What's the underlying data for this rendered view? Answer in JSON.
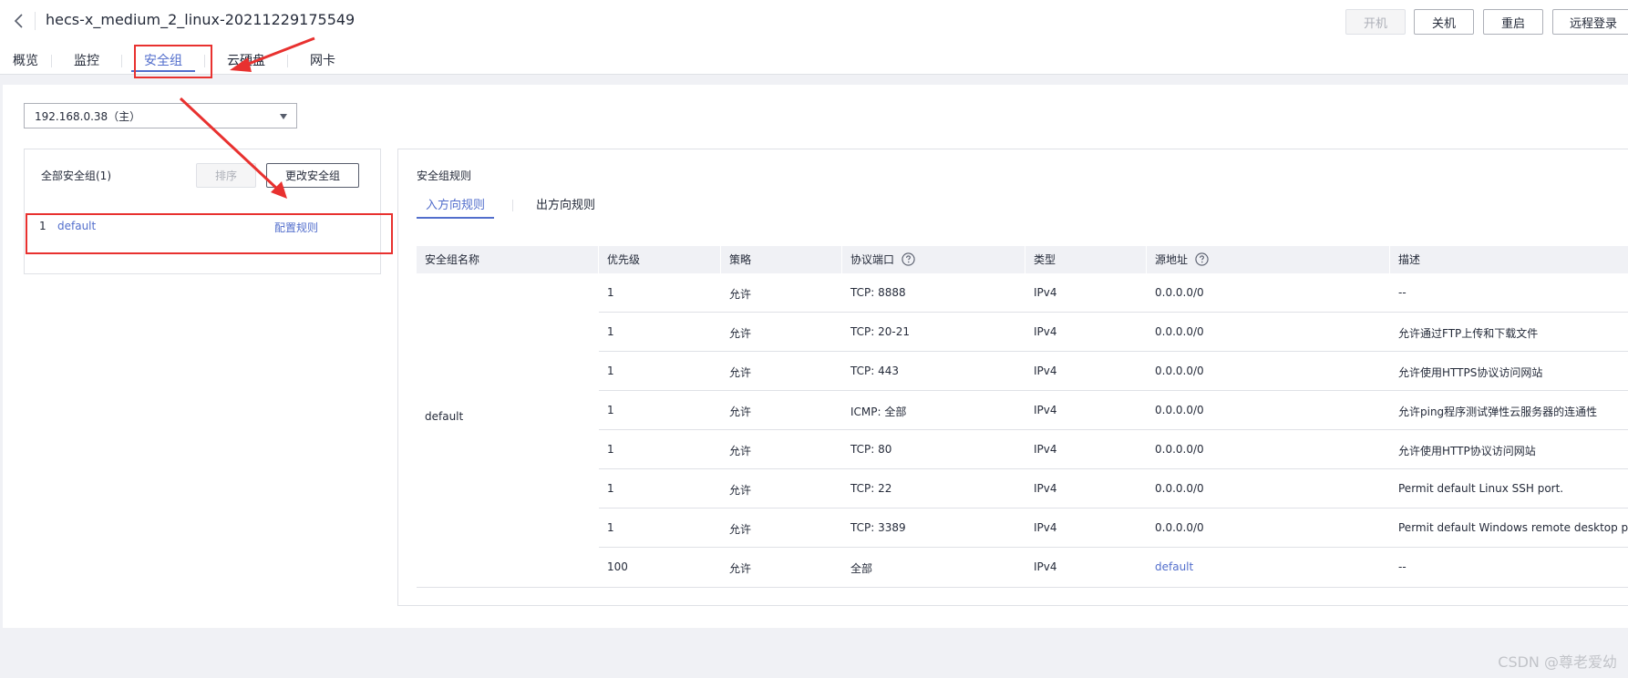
{
  "header": {
    "title": "hecs-x_medium_2_linux-20211229175549",
    "buttons": {
      "start": "开机",
      "stop": "关机",
      "restart": "重启",
      "remote_login": "远程登录"
    }
  },
  "tabs": [
    {
      "label": "概览"
    },
    {
      "label": "监控"
    },
    {
      "label": "安全组"
    },
    {
      "label": "云硬盘"
    },
    {
      "label": "网卡"
    }
  ],
  "nic_select": {
    "value": "192.168.0.38（主）"
  },
  "security_groups": {
    "count_label": "全部安全组(1)",
    "sort_label": "排序",
    "change_label": "更改安全组",
    "items": [
      {
        "index": "1",
        "name": "default",
        "action": "配置规则"
      }
    ]
  },
  "rules": {
    "title": "安全组规则",
    "direction_tabs": [
      "入方向规则",
      "出方向规则"
    ],
    "columns": [
      "安全组名称",
      "优先级",
      "策略",
      "协议端口",
      "类型",
      "源地址",
      "描述"
    ],
    "group_name": "default",
    "rows": [
      {
        "priority": "1",
        "policy": "允许",
        "port": "TCP: 8888",
        "type": "IPv4",
        "source": "0.0.0.0/0",
        "desc": "--"
      },
      {
        "priority": "1",
        "policy": "允许",
        "port": "TCP: 20-21",
        "type": "IPv4",
        "source": "0.0.0.0/0",
        "desc": "允许通过FTP上传和下载文件"
      },
      {
        "priority": "1",
        "policy": "允许",
        "port": "TCP: 443",
        "type": "IPv4",
        "source": "0.0.0.0/0",
        "desc": "允许使用HTTPS协议访问网站"
      },
      {
        "priority": "1",
        "policy": "允许",
        "port": "ICMP: 全部",
        "type": "IPv4",
        "source": "0.0.0.0/0",
        "desc": "允许ping程序测试弹性云服务器的连通性"
      },
      {
        "priority": "1",
        "policy": "允许",
        "port": "TCP: 80",
        "type": "IPv4",
        "source": "0.0.0.0/0",
        "desc": "允许使用HTTP协议访问网站"
      },
      {
        "priority": "1",
        "policy": "允许",
        "port": "TCP: 22",
        "type": "IPv4",
        "source": "0.0.0.0/0",
        "desc": "Permit default Linux SSH port."
      },
      {
        "priority": "1",
        "policy": "允许",
        "port": "TCP: 3389",
        "type": "IPv4",
        "source": "0.0.0.0/0",
        "desc": "Permit default Windows remote desktop p..."
      },
      {
        "priority": "100",
        "policy": "允许",
        "port": "全部",
        "type": "IPv4",
        "source": "default",
        "desc": "--"
      }
    ]
  },
  "watermark": "CSDN @尊老爱幼",
  "colors": {
    "accent": "#526ecc",
    "annotation": "#e8312f"
  }
}
